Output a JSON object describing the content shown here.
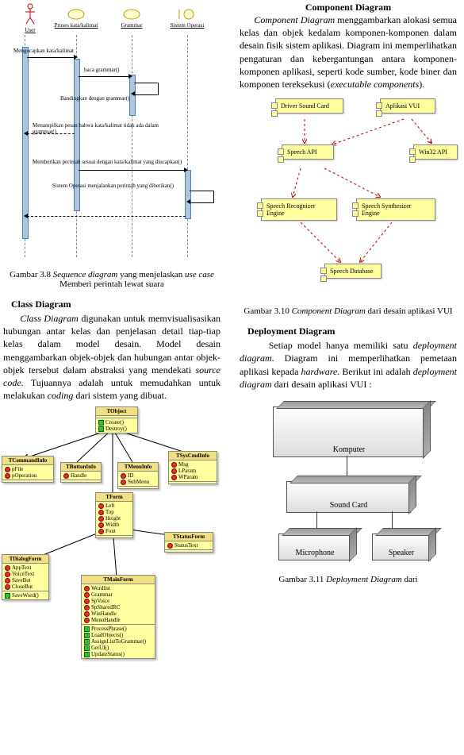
{
  "left": {
    "seq": {
      "actors": [
        "User",
        "Proses kata/kalimat",
        "Grammar",
        "Sistem Operasi"
      ],
      "messages": [
        "Mengucapkan kata/kalimat",
        "baca grammar()",
        "Bandingkan dengan grammar()",
        "Menampilkan pesan bahwa kata/kalimat tidak ada dalam grammar()",
        "Memberikan perintah sesuai dengan kata/kalimat yang diucapkan()",
        "Sistem Operasi menjalankan perintah yang diberikan()"
      ]
    },
    "fig38_pre": "Gambar 3.8 ",
    "fig38_it1": "Sequence diagram",
    "fig38_mid": " yang menjelaskan ",
    "fig38_it2": "use case",
    "fig38_post": " Memberi perintah lewat suara",
    "class_head": "Class Diagram",
    "class_p_1a": "Class Diagram",
    "class_p_1b": " digunakan untuk memvisualisasikan hubungan antar kelas dan penjelasan detail tiap-tiap kelas dalam model desain. Model desain menggambarkan objek-objek dan hubungan antar objek-objek tersebut dalam abstraksi yang mendekati ",
    "class_p_1c": "source code",
    "class_p_1d": ". Tujuannya adalah untuk memudahkan untuk melakukan ",
    "class_p_1e": "coding",
    "class_p_1f": " dari sistem yang dibuat.",
    "classes": {
      "TObject": {
        "ops": [
          "Create()",
          "Destroy()"
        ]
      },
      "TCommandInfo": {
        "attrs": [
          "pFile",
          "pOperation"
        ]
      },
      "TButtonInfo": {
        "attrs": [
          "Handle"
        ]
      },
      "TMenuInfo": {
        "attrs": [
          "ID",
          "SubMenu"
        ]
      },
      "TSysCmdInfo": {
        "attrs": [
          "Msg",
          "LParam",
          "WParam"
        ]
      },
      "TForm": {
        "attrs": [
          "Left",
          "Top",
          "Height",
          "Width",
          "Font"
        ]
      },
      "TDialogForm": {
        "attrs": [
          "AppText",
          "VoiceText",
          "SaveBut",
          "CloseBut"
        ],
        "ops": [
          "SaveWord()"
        ]
      },
      "TStatusForm": {
        "attrs": [
          "StatusText"
        ]
      },
      "TMainForm": {
        "attrs": [
          "Wordlist",
          "Grammar",
          "SpVoice",
          "SpSharedRC",
          "WinHandle",
          "MenuHandle"
        ],
        "ops": [
          "ProcessPhrase()",
          "LoadObjects()",
          "AssignListToGrammar()",
          "GetUI()",
          "UpdateStatus()"
        ]
      }
    }
  },
  "right": {
    "comp_head": "Component Diagram",
    "comp_p_a": "Component Diagram",
    "comp_p_b": " menggambarkan alokasi semua kelas dan objek kedalam komponen-komponen dalam desain fisik sistem aplikasi. Diagram ini memperlihatkan pengaturan dan kebergantungan antara komponen-komponen aplikasi, seperti kode sumber, kode biner dan komponen tereksekusi (",
    "comp_p_c": "executable components",
    "comp_p_d": ").",
    "components": [
      "Driver Sound Card",
      "Aplikasi VUI",
      "Speech API",
      "Win32 API",
      "Speech Recognizer Engine",
      "Speech Synthesizer Engine",
      "Speech Database"
    ],
    "fig310_pre": "Gambar 3.10 ",
    "fig310_it": "Component Diagram",
    "fig310_post": " dari desain aplikasi VUI",
    "dep_head": "Deployment Diagram",
    "dep_p_a": "Setiap model hanya memiliki satu ",
    "dep_p_b": "deployment diagram",
    "dep_p_c": ". Diagram ini memperlihatkan pemetaan aplikasi kepada ",
    "dep_p_d": "hardware",
    "dep_p_e": ". Berikut ini adalah ",
    "dep_p_f": "deployment diagram",
    "dep_p_g": " dari desain aplikasi VUI :",
    "nodes": [
      "Komputer",
      "Sound Card",
      "Microphone",
      "Speaker"
    ],
    "fig311_pre": "Gambar 3.11 ",
    "fig311_it": "Deployment Diagram",
    "fig311_post": " dari"
  }
}
